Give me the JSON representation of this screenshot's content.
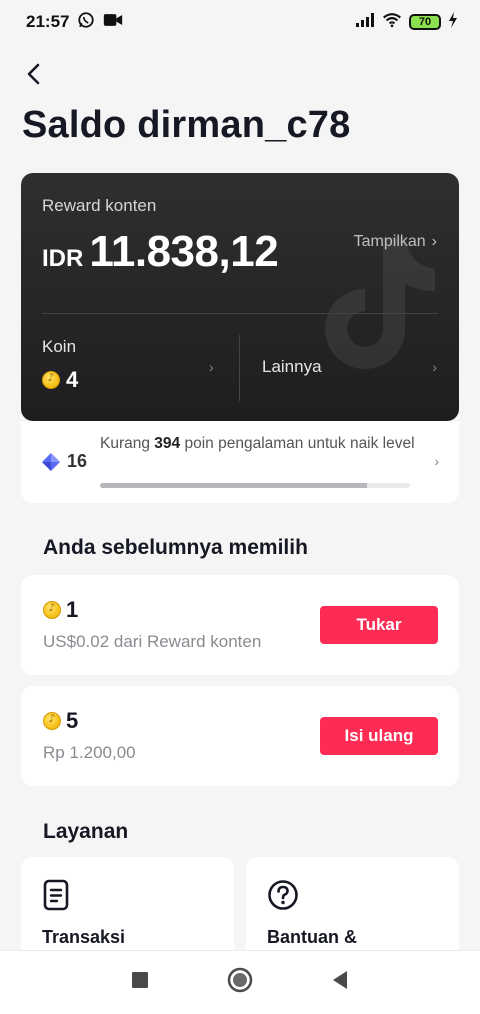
{
  "status_bar": {
    "time": "21:57",
    "battery": "70"
  },
  "header": {
    "title": "Saldo dirman_c78"
  },
  "balance_card": {
    "reward_label": "Reward konten",
    "currency": "IDR",
    "amount": "11.838,12",
    "show_label": "Tampilkan",
    "coins_label": "Koin",
    "coins_value": "4",
    "others_label": "Lainnya"
  },
  "level": {
    "number": "16",
    "text_prefix": "Kurang",
    "points": "394",
    "text_suffix": "poin pengalaman untuk naik level",
    "progress_fraction": 0.86
  },
  "previous_choices": {
    "title": "Anda sebelumnya memilih",
    "items": [
      {
        "coins": "1",
        "subtitle": "US$0.02 dari Reward konten",
        "button": "Tukar"
      },
      {
        "coins": "5",
        "subtitle": "Rp 1.200,00",
        "button": "Isi ulang"
      }
    ]
  },
  "services": {
    "title": "Layanan",
    "items": [
      {
        "label": "Transaksi",
        "icon": "document-icon"
      },
      {
        "label": "Bantuan &",
        "icon": "help-icon"
      }
    ]
  },
  "colors": {
    "accent": "#fe2c55",
    "card_dark": "#262628",
    "background": "#f5f5f6"
  }
}
